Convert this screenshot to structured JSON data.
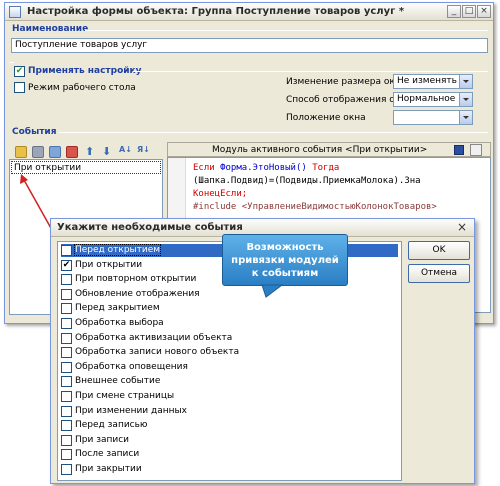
{
  "main_window": {
    "title": "Настройка формы объекта: Группа Поступление товаров услуг *",
    "name_section_label": "Наименование",
    "name_value": "Поступление товаров услуг",
    "apply_settings_label": "Применять настройку",
    "apply_settings_checked": true,
    "desktop_mode_label": "Режим рабочего стола",
    "desktop_mode_checked": false,
    "resize_label": "Изменение размера окна",
    "resize_value": "Не изменять",
    "display_mode_label": "Способ отображения окна",
    "display_mode_value": "Нормальное",
    "position_label": "Положение окна",
    "position_value": "",
    "events_section_label": "События",
    "events_list": [
      "При открытии"
    ],
    "module_header": "Модуль активного события <При открытии>",
    "code_lines": [
      {
        "parts": [
          {
            "t": "Если ",
            "c": "kw"
          },
          {
            "t": "Форма.ЭтоНовый() ",
            "c": "fn"
          },
          {
            "t": "Тогда",
            "c": "kw"
          }
        ]
      },
      {
        "parts": [
          {
            "t": "    (Шапка.Подвид)=(Подвиды.ПриемкаМолока).Зна",
            "c": "plain"
          }
        ]
      },
      {
        "parts": [
          {
            "t": "КонецЕсли;",
            "c": "kw"
          }
        ]
      },
      {
        "parts": [
          {
            "t": "#include <УправлениеВидимостьюКолонокТоваров>",
            "c": "hl"
          }
        ]
      }
    ]
  },
  "dialog": {
    "title": "Укажите необходимые события",
    "ok_label": "OK",
    "cancel_label": "Отмена",
    "events": [
      {
        "label": "Перед открытием",
        "checked": false,
        "selected": true
      },
      {
        "label": "При открытии",
        "checked": true,
        "selected": false
      },
      {
        "label": "При повторном открытии",
        "checked": false,
        "selected": false
      },
      {
        "label": "Обновление отображения",
        "checked": false,
        "selected": false
      },
      {
        "label": "Перед закрытием",
        "checked": false,
        "selected": false
      },
      {
        "label": "Обработка выбора",
        "checked": false,
        "selected": false
      },
      {
        "label": "Обработка активизации объекта",
        "checked": false,
        "selected": false
      },
      {
        "label": "Обработка записи нового объекта",
        "checked": false,
        "selected": false
      },
      {
        "label": "Обработка оповещения",
        "checked": false,
        "selected": false
      },
      {
        "label": "Внешнее событие",
        "checked": false,
        "selected": false
      },
      {
        "label": "При смене страницы",
        "checked": false,
        "selected": false
      },
      {
        "label": "При изменении данных",
        "checked": false,
        "selected": false
      },
      {
        "label": "Перед записью",
        "checked": false,
        "selected": false
      },
      {
        "label": "При записи",
        "checked": false,
        "selected": false
      },
      {
        "label": "После записи",
        "checked": false,
        "selected": false
      },
      {
        "label": "При закрытии",
        "checked": false,
        "selected": false
      }
    ]
  },
  "callout_lines": [
    "Возможность",
    "привязки модулей",
    "к событиям"
  ],
  "colors": {
    "section_label": "#1f3f9f",
    "selection": "#316ac5",
    "callout": "#2a7fc4",
    "arrow": "#d42020",
    "keyword": "#d40000"
  }
}
